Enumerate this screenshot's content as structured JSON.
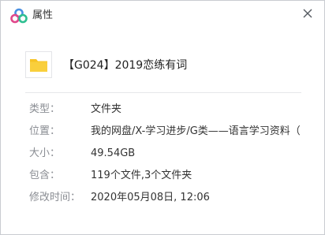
{
  "window": {
    "title": "属性",
    "close_icon": "close-icon",
    "logo_icon": "cloud-drive-logo-icon",
    "logo_colors": [
      "#4a90e2",
      "#e0478b",
      "#2ebf91"
    ]
  },
  "file": {
    "name": "【G024】2019恋练有词",
    "icon": "folder-icon",
    "icon_color": "#f7c325"
  },
  "properties": [
    {
      "label": "类型：",
      "value": "文件夹"
    },
    {
      "label": "位置：",
      "value": "我的网盘/X-学习进步/G类——语言学习资料（..."
    },
    {
      "label": "大小：",
      "value": "49.54GB"
    },
    {
      "label": "包含：",
      "value": "119个文件,3个文件夹"
    },
    {
      "label": "修改时间：",
      "value": "2020年05月08日, 12:06"
    }
  ]
}
